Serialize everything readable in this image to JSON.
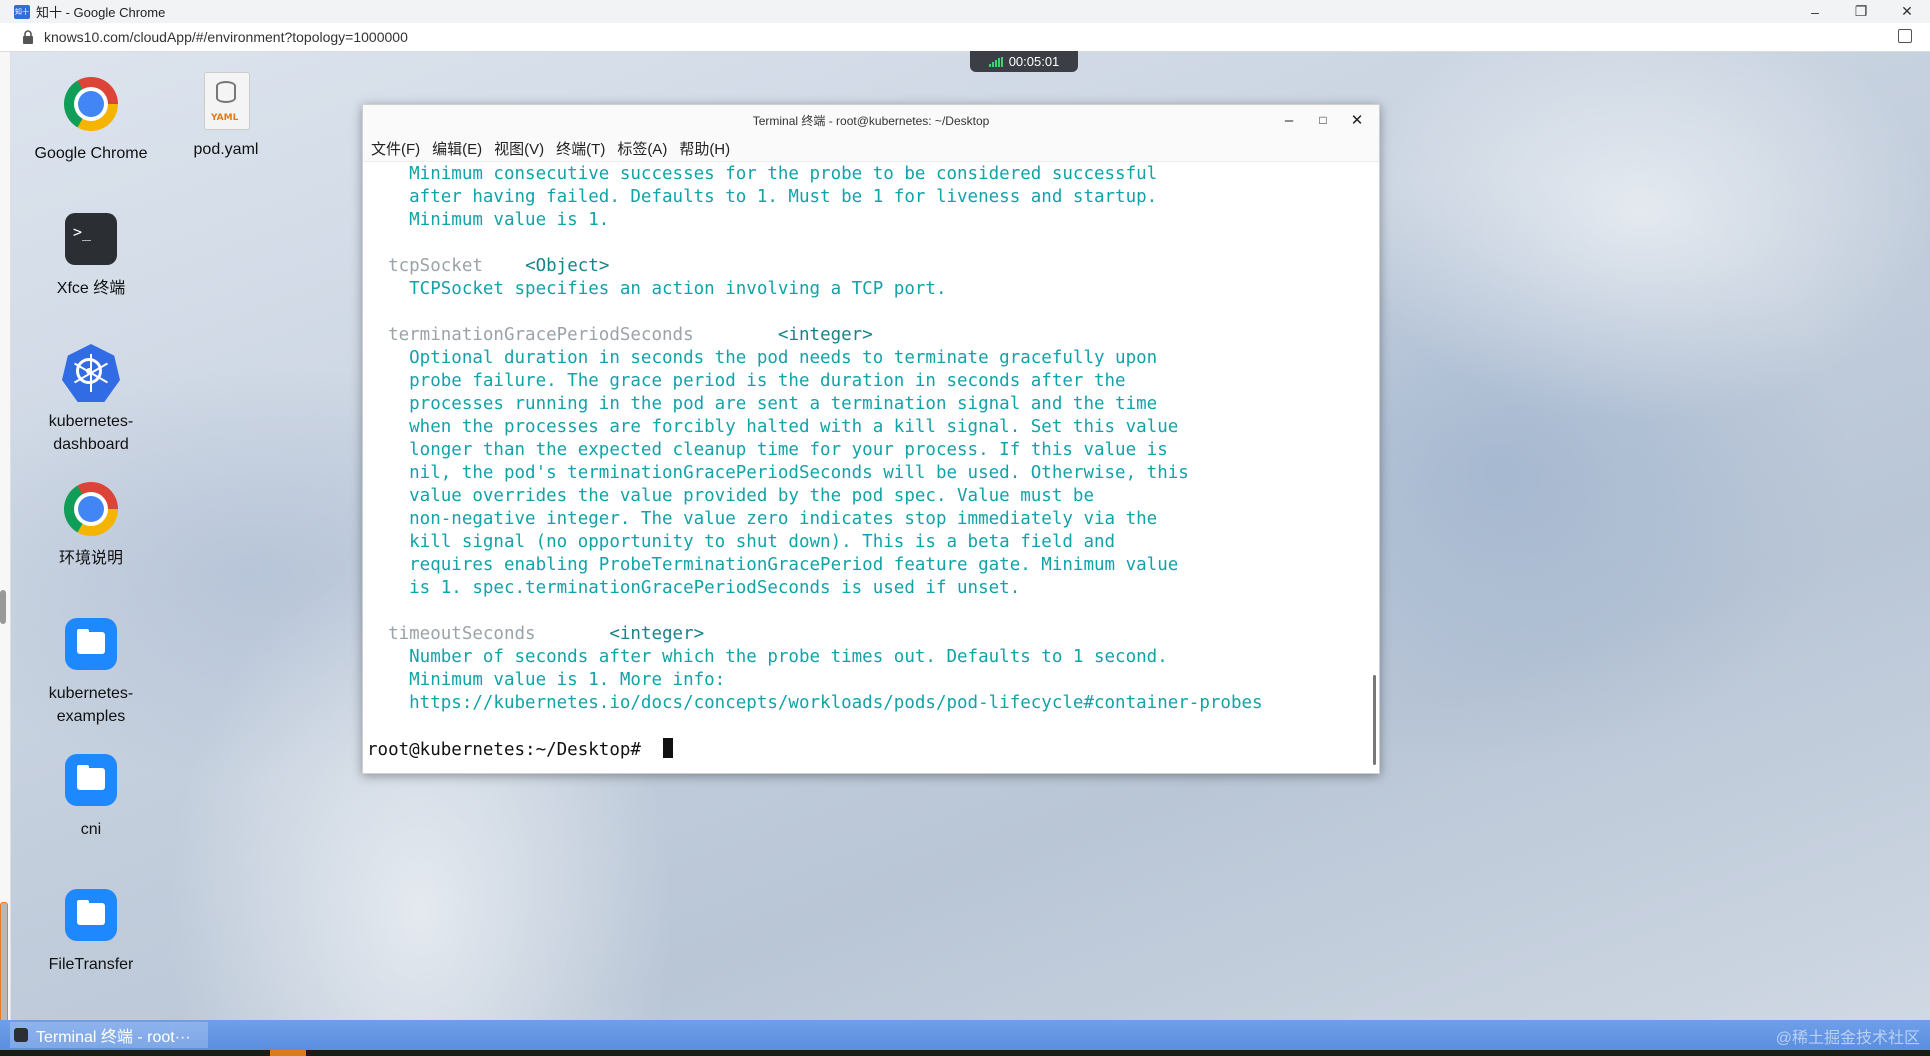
{
  "browser": {
    "title": "知十 - Google Chrome",
    "favicon": "知十",
    "url": "knows10.com/cloudApp/#/environment?topology=1000000",
    "controls": {
      "minimize": "–",
      "restore": "❐",
      "close": "✕"
    }
  },
  "recording": {
    "time": "00:05:01"
  },
  "desktop": {
    "icons": [
      {
        "label": "Google Chrome",
        "icon": "chrome-icon"
      },
      {
        "label": "pod.yaml",
        "icon": "yaml-file-icon",
        "badge": "YAML"
      },
      {
        "label": "Xfce 终端",
        "icon": "terminal-icon",
        "glyph": ">_"
      },
      {
        "label": "kubernetes-dashboard",
        "icon": "kubernetes-icon"
      },
      {
        "label": "环境说明",
        "icon": "chrome-icon"
      },
      {
        "label": "kubernetes-examples",
        "icon": "folder-icon"
      },
      {
        "label": "cni",
        "icon": "folder-icon"
      },
      {
        "label": "FileTransfer",
        "icon": "folder-icon"
      }
    ]
  },
  "terminal": {
    "title": "Terminal 终端 - root@kubernetes: ~/Desktop",
    "controls": {
      "minimize": "–",
      "maximize": "□",
      "close": "✕"
    },
    "menu": [
      "文件(F)",
      "编辑(E)",
      "视图(V)",
      "终端(T)",
      "标签(A)",
      "帮助(H)"
    ],
    "lines": [
      {
        "kind": "desc",
        "text": "    Minimum consecutive successes for the probe to be considered successful"
      },
      {
        "kind": "desc",
        "text": "    after having failed. Defaults to 1. Must be 1 for liveness and startup."
      },
      {
        "kind": "desc",
        "text": "    Minimum value is 1."
      },
      {
        "kind": "blank",
        "text": ""
      },
      {
        "kind": "field",
        "field": "  tcpSocket",
        "gap": "    ",
        "type": "<Object>"
      },
      {
        "kind": "desc",
        "text": "    TCPSocket specifies an action involving a TCP port."
      },
      {
        "kind": "blank",
        "text": ""
      },
      {
        "kind": "field",
        "field": "  terminationGracePeriodSeconds",
        "gap": "        ",
        "type": "<integer>"
      },
      {
        "kind": "desc",
        "text": "    Optional duration in seconds the pod needs to terminate gracefully upon"
      },
      {
        "kind": "desc",
        "text": "    probe failure. The grace period is the duration in seconds after the"
      },
      {
        "kind": "desc",
        "text": "    processes running in the pod are sent a termination signal and the time"
      },
      {
        "kind": "desc",
        "text": "    when the processes are forcibly halted with a kill signal. Set this value"
      },
      {
        "kind": "desc",
        "text": "    longer than the expected cleanup time for your process. If this value is"
      },
      {
        "kind": "desc",
        "text": "    nil, the pod's terminationGracePeriodSeconds will be used. Otherwise, this"
      },
      {
        "kind": "desc",
        "text": "    value overrides the value provided by the pod spec. Value must be"
      },
      {
        "kind": "desc",
        "text": "    non-negative integer. The value zero indicates stop immediately via the"
      },
      {
        "kind": "desc",
        "text": "    kill signal (no opportunity to shut down). This is a beta field and"
      },
      {
        "kind": "desc",
        "text": "    requires enabling ProbeTerminationGracePeriod feature gate. Minimum value"
      },
      {
        "kind": "desc",
        "text": "    is 1. spec.terminationGracePeriodSeconds is used if unset."
      },
      {
        "kind": "blank",
        "text": ""
      },
      {
        "kind": "field",
        "field": "  timeoutSeconds",
        "gap": "       ",
        "type": "<integer>"
      },
      {
        "kind": "desc",
        "text": "    Number of seconds after which the probe times out. Defaults to 1 second."
      },
      {
        "kind": "desc",
        "text": "    Minimum value is 1. More info:"
      },
      {
        "kind": "desc",
        "text": "    https://kubernetes.io/docs/concepts/workloads/pods/pod-lifecycle#container-probes"
      },
      {
        "kind": "blank",
        "text": ""
      },
      {
        "kind": "prompt",
        "text": "root@kubernetes:~/Desktop# "
      }
    ]
  },
  "taskbar": {
    "task_label": "Terminal 终端 - root···",
    "watermark": "@稀土掘金技术社区"
  }
}
